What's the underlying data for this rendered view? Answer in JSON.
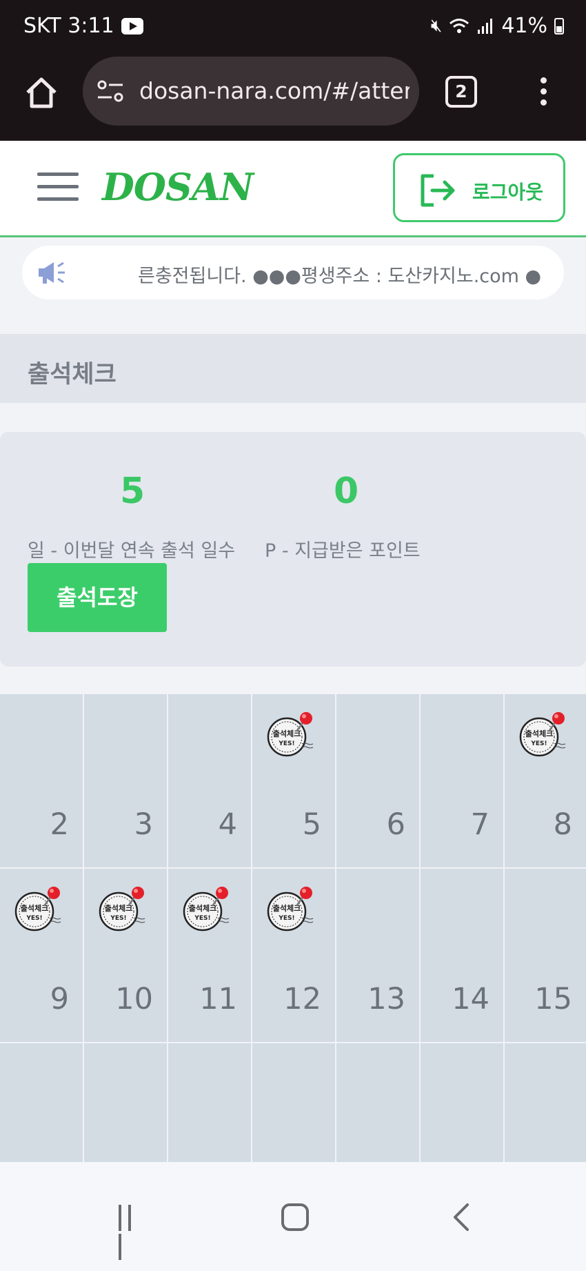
{
  "status_bar": {
    "carrier_time": "SKT 3:11",
    "battery": "41%",
    "icons": [
      "youtube-icon",
      "mute-icon",
      "wifi-icon",
      "signal-icon",
      "battery-icon"
    ]
  },
  "browser": {
    "url": "dosan-nara.com/#/atter",
    "tab_count": "2"
  },
  "header": {
    "logo_text": "DOSAN",
    "logout_label": "로그아웃"
  },
  "notice": {
    "text": "른충전됩니다. ●●●평생주소 : 도산카지노.com ●"
  },
  "page": {
    "title": "출석체크"
  },
  "stats": {
    "days_value": "5",
    "days_label": "일 - 이번달 연속 출석 일수",
    "points_value": "0",
    "points_label": "P - 지급받은 포인트",
    "attend_button": "출석도장"
  },
  "calendar": {
    "stamp_text": "출석체크",
    "stamp_sub": "YES!",
    "weeks": [
      [
        {
          "day": "2",
          "stamped": false
        },
        {
          "day": "3",
          "stamped": false
        },
        {
          "day": "4",
          "stamped": false
        },
        {
          "day": "5",
          "stamped": true
        },
        {
          "day": "6",
          "stamped": false
        },
        {
          "day": "7",
          "stamped": false
        },
        {
          "day": "8",
          "stamped": true
        }
      ],
      [
        {
          "day": "9",
          "stamped": true
        },
        {
          "day": "10",
          "stamped": true
        },
        {
          "day": "11",
          "stamped": true
        },
        {
          "day": "12",
          "stamped": true
        },
        {
          "day": "13",
          "stamped": false
        },
        {
          "day": "14",
          "stamped": false
        },
        {
          "day": "15",
          "stamped": false
        }
      ],
      [
        {
          "day": "",
          "stamped": false
        },
        {
          "day": "",
          "stamped": false
        },
        {
          "day": "",
          "stamped": false
        },
        {
          "day": "",
          "stamped": false
        },
        {
          "day": "",
          "stamped": false
        },
        {
          "day": "",
          "stamped": false
        },
        {
          "day": "",
          "stamped": false
        }
      ]
    ]
  },
  "colors": {
    "accent_green": "#3cc766",
    "status_bar_bg": "#1b1416",
    "calendar_cell": "#d3dbe3"
  }
}
